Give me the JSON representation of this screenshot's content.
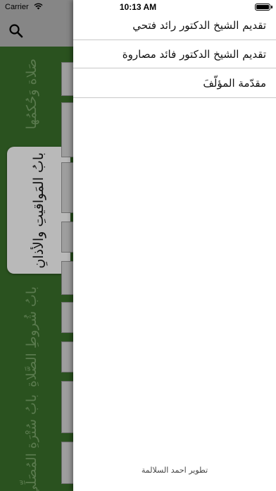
{
  "status_bar": {
    "carrier": "Carrier",
    "time": "10:13 AM"
  },
  "left_panel": {
    "search_icon": "search-icon",
    "tabs": [
      {
        "label": "صَلاة وَحُكمُها"
      },
      {
        "label": "بابُ المَواقيتِ والأذانِ"
      },
      {
        "label": "بابُ شُروطِ الصَّلاةِ"
      },
      {
        "label": "بابُ سُتْرَةِ المُصَلِّي"
      }
    ]
  },
  "drawer": {
    "items": [
      {
        "label": "تقديم الشيخ الدكتور رائد فتحي"
      },
      {
        "label": "تقديم الشيخ الدكتور فائد مصاروة"
      },
      {
        "label": "مقدّمة المؤلّفَ"
      }
    ],
    "developer": "تطوير احمد السلالمة"
  },
  "colors": {
    "panel_green": "#2a521f",
    "topbar_gray": "#868686",
    "active_tab": "#b9b9b9"
  }
}
